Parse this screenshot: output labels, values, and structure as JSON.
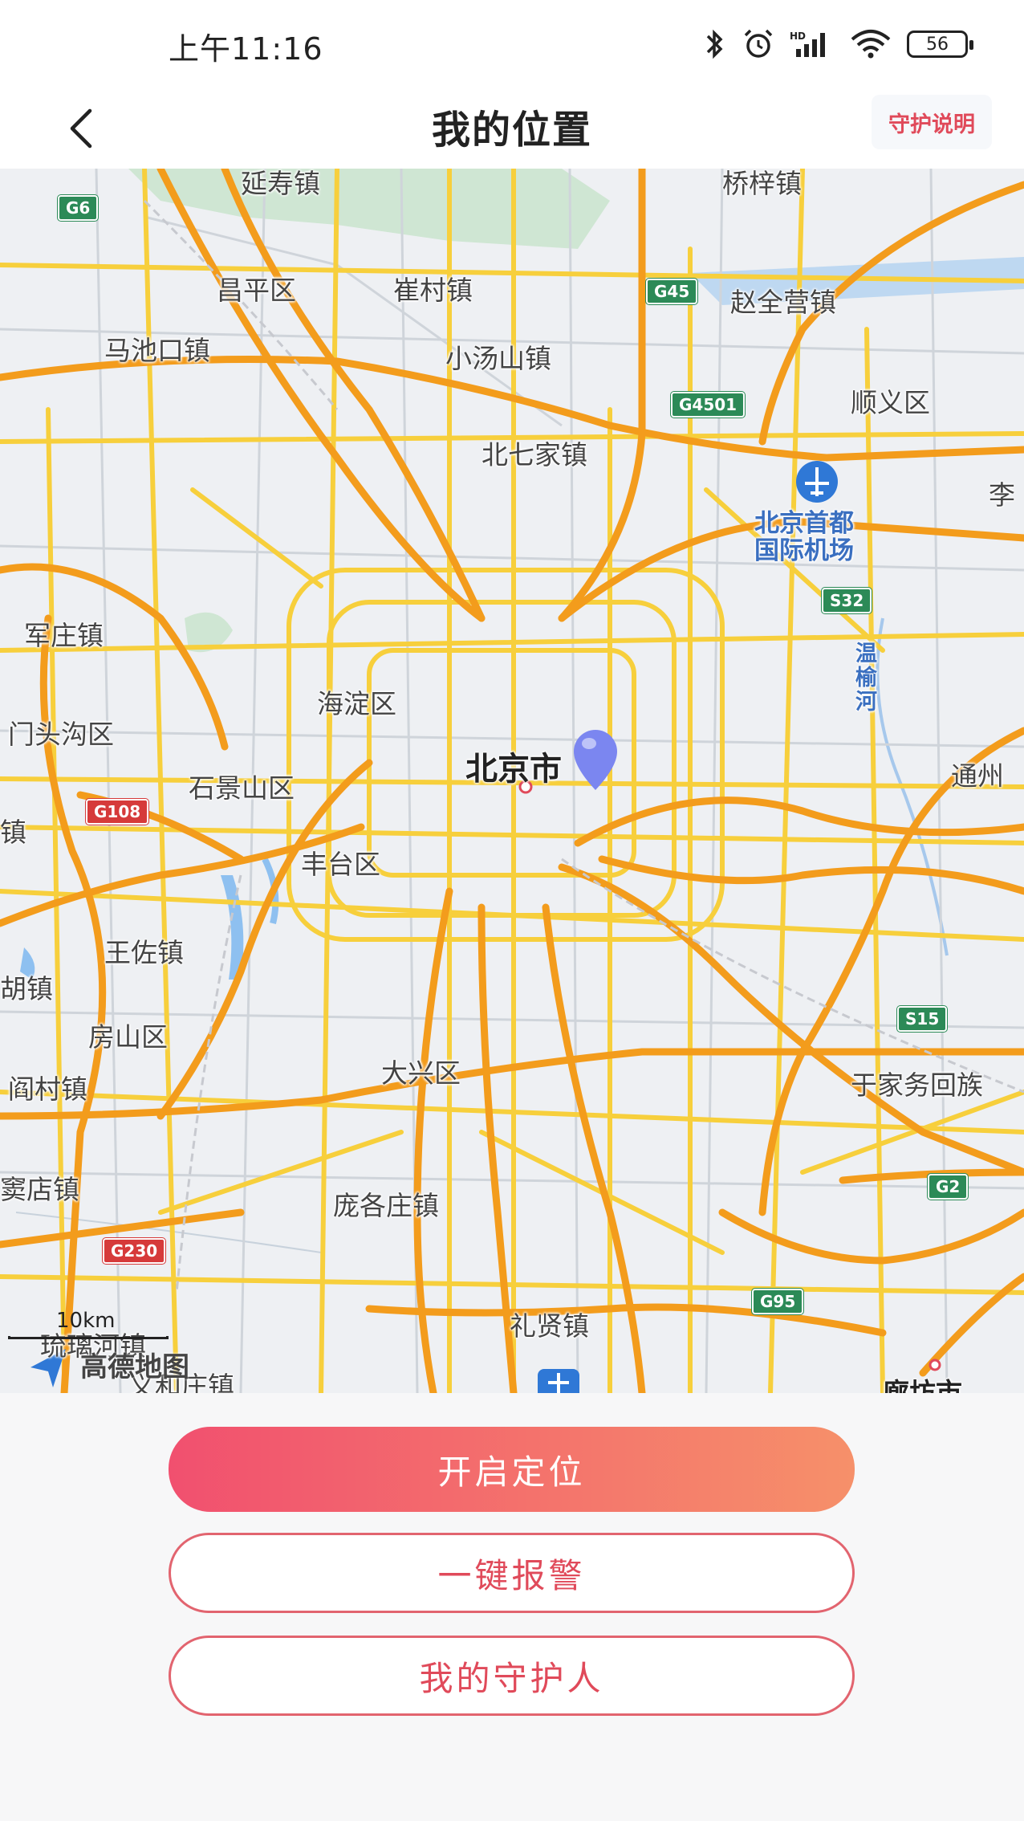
{
  "status_bar": {
    "time": "上午11:16",
    "battery": "56"
  },
  "header": {
    "title": "我的位置",
    "guard_info": "守护说明"
  },
  "map": {
    "labels": {
      "yanshou": "延寿镇",
      "qiaozi": "桥梓镇",
      "changping": "昌平区",
      "cuicun": "崔村镇",
      "zhaoquanying": "赵全营镇",
      "machikou": "马池口镇",
      "xiaotangshan": "小汤山镇",
      "shunyi": "顺义区",
      "beiqijia": "北七家镇",
      "li": "李",
      "airport": "北京首都\n国际机场",
      "junzhuang": "军庄镇",
      "wenyu": "温\n榆\n河",
      "haidian": "海淀区",
      "mentougou": "门头沟区",
      "beijing": "北京市",
      "tongzhou": "通州",
      "shijingshan": "石景山区",
      "zhen_left": "镇",
      "fengtai": "丰台区",
      "wangzuo": "王佐镇",
      "hu": "胡镇",
      "fangshan": "房山区",
      "daxing": "大兴区",
      "yujiawu": "于家务回族",
      "yancun": "阎村镇",
      "doudian": "窦店镇",
      "pangezhuang": "庞各庄镇",
      "lixian": "礼贤镇",
      "liulihe": "琉璃河镇",
      "yihezhuang": "义和庄镇",
      "langfang": "廊坊市"
    },
    "shields": {
      "g6": "G6",
      "g45": "G45",
      "g4501": "G4501",
      "s32": "S32",
      "g108": "G108",
      "s15": "S15",
      "g2": "G2",
      "g230": "G230",
      "g95": "G95"
    },
    "scale": "10km",
    "logo": "高德地图"
  },
  "actions": {
    "enable_location": "开启定位",
    "one_key_alarm": "一键报警",
    "my_guardians": "我的守护人"
  }
}
